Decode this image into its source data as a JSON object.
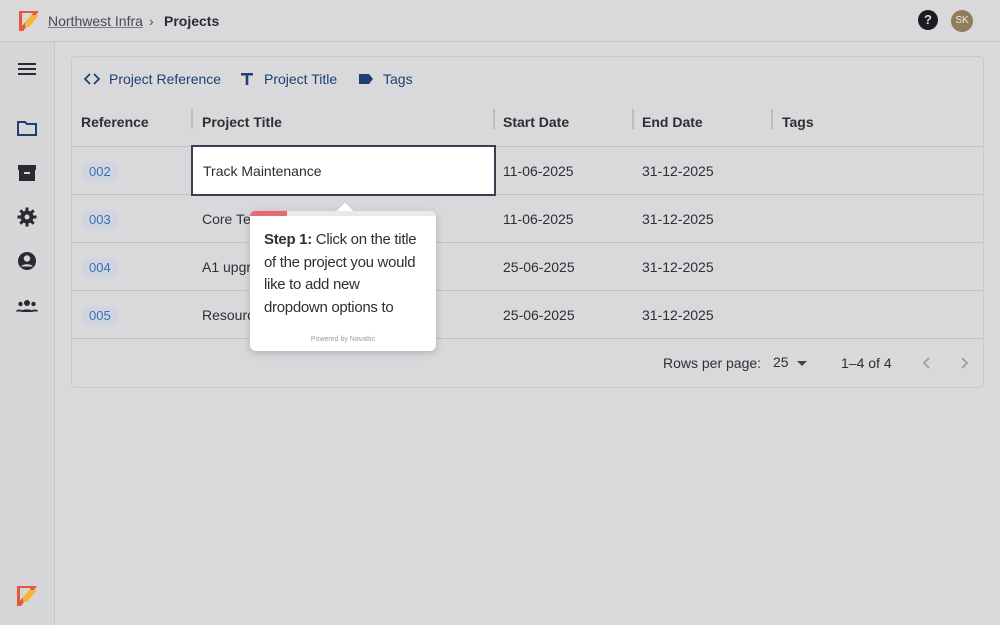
{
  "breadcrumb": {
    "parent": "Northwest Infra",
    "separator": "›",
    "current": "Projects"
  },
  "header": {
    "help_icon": "help-circle-icon",
    "avatar_initials": "SK"
  },
  "sidebar": {
    "items": [
      {
        "icon": "menu-icon"
      },
      {
        "icon": "folder-icon"
      },
      {
        "icon": "archive-icon"
      },
      {
        "icon": "gear-icon"
      },
      {
        "icon": "account-circle-icon"
      },
      {
        "icon": "group-icon"
      }
    ]
  },
  "toolbar": {
    "project_reference": "Project Reference",
    "project_title": "Project Title",
    "tags": "Tags"
  },
  "table": {
    "columns": [
      "Reference",
      "Project Title",
      "Start Date",
      "End Date",
      "Tags"
    ],
    "rows": [
      {
        "ref": "002",
        "title": "Track Maintenance",
        "start": "11-06-2025",
        "end": "31-12-2025",
        "tags": ""
      },
      {
        "ref": "003",
        "title": "Core Te",
        "start": "11-06-2025",
        "end": "31-12-2025",
        "tags": ""
      },
      {
        "ref": "004",
        "title": "A1 upgra",
        "start": "25-06-2025",
        "end": "31-12-2025",
        "tags": ""
      },
      {
        "ref": "005",
        "title": "Resourc",
        "start": "25-06-2025",
        "end": "31-12-2025",
        "tags": ""
      }
    ]
  },
  "pagination": {
    "rows_per_page_label": "Rows per page:",
    "rows_per_page": "25",
    "range": "1–4 of 4"
  },
  "tooltip": {
    "step_label": "Step 1:",
    "text": " Click on the title of the project you would like to add new dropdown options to",
    "powered_by": "Powered by Navattic",
    "progress": 0.2
  },
  "colors": {
    "accent": "#1e3f73",
    "chip_text": "#3a6fb4",
    "tooltip_progress": "#e86a74"
  }
}
